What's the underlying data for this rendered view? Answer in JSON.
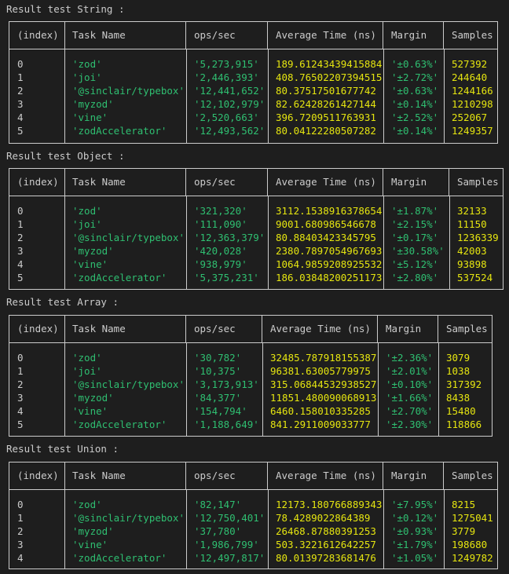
{
  "headers": {
    "index": "(index)",
    "task": "Task Name",
    "ops": "ops/sec",
    "avg": "Average Time (ns)",
    "margin": "Margin",
    "samples": "Samples"
  },
  "blocks": [
    {
      "title": "Result test String :",
      "rows": [
        {
          "index": "0",
          "task": "'zod'",
          "ops": "'5,273,915'",
          "avg": "189.61243439415884",
          "margin": "'±0.63%'",
          "samples": "527392"
        },
        {
          "index": "1",
          "task": "'joi'",
          "ops": "'2,446,393'",
          "avg": "408.76502207394515",
          "margin": "'±2.72%'",
          "samples": "244640"
        },
        {
          "index": "2",
          "task": "'@sinclair/typebox'",
          "ops": "'12,441,652'",
          "avg": "80.37517501677742",
          "margin": "'±0.63%'",
          "samples": "1244166"
        },
        {
          "index": "3",
          "task": "'myzod'",
          "ops": "'12,102,979'",
          "avg": "82.62428261427144",
          "margin": "'±0.14%'",
          "samples": "1210298"
        },
        {
          "index": "4",
          "task": "'vine'",
          "ops": "'2,520,663'",
          "avg": "396.7209511763931",
          "margin": "'±2.52%'",
          "samples": "252067"
        },
        {
          "index": "5",
          "task": "'zodAccelerator'",
          "ops": "'12,493,562'",
          "avg": "80.04122280507282",
          "margin": "'±0.14%'",
          "samples": "1249357"
        }
      ]
    },
    {
      "title": "Result test Object :",
      "rows": [
        {
          "index": "0",
          "task": "'zod'",
          "ops": "'321,320'",
          "avg": "3112.1538916378654",
          "margin": "'±1.87%'",
          "samples": "32133"
        },
        {
          "index": "1",
          "task": "'joi'",
          "ops": "'111,090'",
          "avg": "9001.680986546678",
          "margin": "'±2.15%'",
          "samples": "11150"
        },
        {
          "index": "2",
          "task": "'@sinclair/typebox'",
          "ops": "'12,363,379'",
          "avg": "80.88403423345795",
          "margin": "'±0.17%'",
          "samples": "1236339"
        },
        {
          "index": "3",
          "task": "'myzod'",
          "ops": "'420,028'",
          "avg": "2380.7897054967693",
          "margin": "'±30.58%'",
          "samples": "42003"
        },
        {
          "index": "4",
          "task": "'vine'",
          "ops": "'938,979'",
          "avg": "1064.9859208925532",
          "margin": "'±5.12%'",
          "samples": "93898"
        },
        {
          "index": "5",
          "task": "'zodAccelerator'",
          "ops": "'5,375,231'",
          "avg": "186.03848200251173",
          "margin": "'±2.80%'",
          "samples": "537524"
        }
      ]
    },
    {
      "title": "Result test Array :",
      "rows": [
        {
          "index": "0",
          "task": "'zod'",
          "ops": "'30,782'",
          "avg": "32485.787918155387",
          "margin": "'±2.36%'",
          "samples": "3079"
        },
        {
          "index": "1",
          "task": "'joi'",
          "ops": "'10,375'",
          "avg": "96381.63005779975",
          "margin": "'±2.01%'",
          "samples": "1038"
        },
        {
          "index": "2",
          "task": "'@sinclair/typebox'",
          "ops": "'3,173,913'",
          "avg": "315.06844532938527",
          "margin": "'±0.10%'",
          "samples": "317392"
        },
        {
          "index": "3",
          "task": "'myzod'",
          "ops": "'84,377'",
          "avg": "11851.480090068913",
          "margin": "'±1.66%'",
          "samples": "8438"
        },
        {
          "index": "4",
          "task": "'vine'",
          "ops": "'154,794'",
          "avg": "6460.158010335285",
          "margin": "'±2.70%'",
          "samples": "15480"
        },
        {
          "index": "5",
          "task": "'zodAccelerator'",
          "ops": "'1,188,649'",
          "avg": "841.2911009033777",
          "margin": "'±2.30%'",
          "samples": "118866"
        }
      ]
    },
    {
      "title": "Result test Union :",
      "rows": [
        {
          "index": "0",
          "task": "'zod'",
          "ops": "'82,147'",
          "avg": "12173.180766889343",
          "margin": "'±7.95%'",
          "samples": "8215"
        },
        {
          "index": "1",
          "task": "'@sinclair/typebox'",
          "ops": "'12,750,401'",
          "avg": "78.4289022864389",
          "margin": "'±0.12%'",
          "samples": "1275041"
        },
        {
          "index": "2",
          "task": "'myzod'",
          "ops": "'37,780'",
          "avg": "26468.87880391253",
          "margin": "'±0.93%'",
          "samples": "3779"
        },
        {
          "index": "3",
          "task": "'vine'",
          "ops": "'1,986,799'",
          "avg": "503.3221612642257",
          "margin": "'±1.79%'",
          "samples": "198680"
        },
        {
          "index": "4",
          "task": "'zodAccelerator'",
          "ops": "'12,497,817'",
          "avg": "80.01397283681476",
          "margin": "'±1.05%'",
          "samples": "1249782"
        }
      ]
    }
  ]
}
